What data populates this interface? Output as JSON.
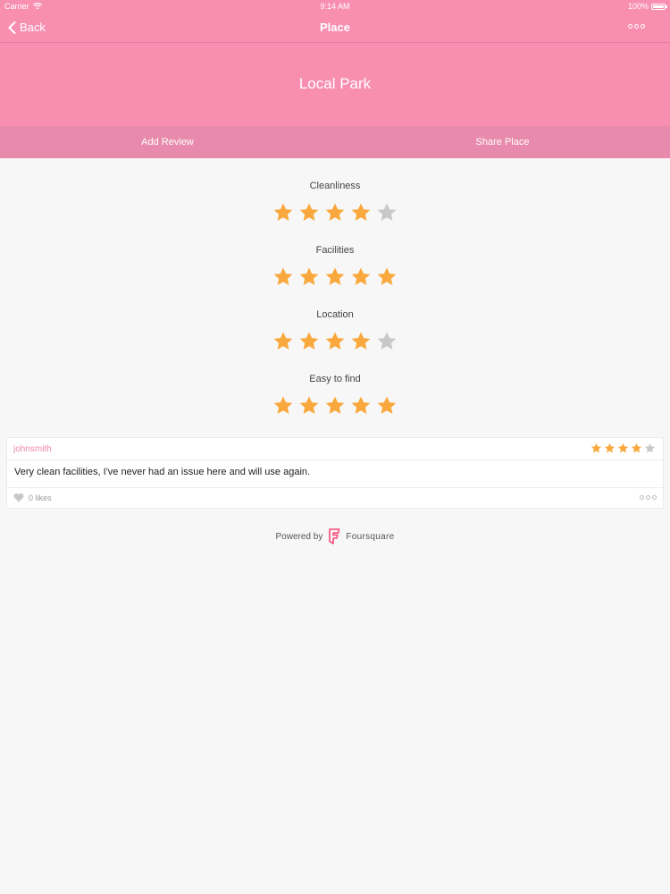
{
  "status_bar": {
    "carrier": "Carrier",
    "time": "9:14 AM",
    "battery": "100%"
  },
  "nav": {
    "back_label": "Back",
    "title": "Place",
    "more_icon": "more-icon"
  },
  "place": {
    "name": "Local Park"
  },
  "actions": {
    "add_review": "Add Review",
    "share_place": "Share Place"
  },
  "ratings": [
    {
      "label": "Cleanliness",
      "score": 4,
      "max": 5
    },
    {
      "label": "Facilities",
      "score": 5,
      "max": 5
    },
    {
      "label": "Location",
      "score": 4,
      "max": 5
    },
    {
      "label": "Easy to find",
      "score": 5,
      "max": 5
    }
  ],
  "review": {
    "user": "johnsmith",
    "score": 4,
    "max": 5,
    "text": "Very clean facilities, I've never had an issue here and will use again.",
    "likes": "0 likes"
  },
  "footer": {
    "powered_by": "Powered by",
    "brand": "Foursquare"
  },
  "colors": {
    "brand_pink": "#f88fb1",
    "action_bar": "#e88aab",
    "star_filled": "#f8a83c",
    "star_empty": "#c8c8c8",
    "username": "#f088aa",
    "foursquare": "#f94877"
  }
}
